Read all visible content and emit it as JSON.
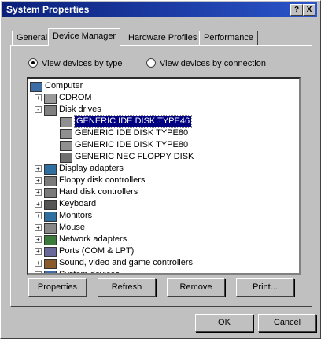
{
  "window": {
    "title": "System Properties",
    "help_btn": "?",
    "close_btn": "X"
  },
  "tabs": [
    "General",
    "Device Manager",
    "Hardware Profiles",
    "Performance"
  ],
  "view": {
    "by_type": "View devices by type",
    "by_connection": "View devices by connection",
    "selected": "by_type"
  },
  "tree": [
    {
      "label": "Computer",
      "icon": "computer-icon",
      "level": 0,
      "expander": ""
    },
    {
      "label": "CDROM",
      "icon": "cdrom-icon",
      "level": 1,
      "expander": "+"
    },
    {
      "label": "Disk drives",
      "icon": "disk-drive-icon",
      "level": 1,
      "expander": "-"
    },
    {
      "label": "GENERIC IDE  DISK TYPE46",
      "icon": "hard-disk-icon",
      "level": 2,
      "expander": "",
      "selected": true
    },
    {
      "label": "GENERIC IDE  DISK TYPE80",
      "icon": "hard-disk-icon",
      "level": 2,
      "expander": ""
    },
    {
      "label": "GENERIC IDE  DISK TYPE80",
      "icon": "hard-disk-icon",
      "level": 2,
      "expander": ""
    },
    {
      "label": "GENERIC NEC  FLOPPY DISK",
      "icon": "floppy-icon",
      "level": 2,
      "expander": ""
    },
    {
      "label": "Display adapters",
      "icon": "display-icon",
      "level": 1,
      "expander": "+"
    },
    {
      "label": "Floppy disk controllers",
      "icon": "controller-icon",
      "level": 1,
      "expander": "+"
    },
    {
      "label": "Hard disk controllers",
      "icon": "controller-icon",
      "level": 1,
      "expander": "+"
    },
    {
      "label": "Keyboard",
      "icon": "keyboard-icon",
      "level": 1,
      "expander": "+"
    },
    {
      "label": "Monitors",
      "icon": "monitor-icon",
      "level": 1,
      "expander": "+"
    },
    {
      "label": "Mouse",
      "icon": "mouse-icon",
      "level": 1,
      "expander": "+"
    },
    {
      "label": "Network adapters",
      "icon": "network-icon",
      "level": 1,
      "expander": "+"
    },
    {
      "label": "Ports (COM & LPT)",
      "icon": "port-icon",
      "level": 1,
      "expander": "+"
    },
    {
      "label": "Sound, video and game controllers",
      "icon": "sound-icon",
      "level": 1,
      "expander": "+"
    },
    {
      "label": "System devices",
      "icon": "system-icon",
      "level": 1,
      "expander": "+"
    }
  ],
  "buttons": {
    "properties": "Properties",
    "refresh": "Refresh",
    "remove": "Remove",
    "print": "Print...",
    "ok": "OK",
    "cancel": "Cancel"
  },
  "scrollbar": {
    "up": "▲",
    "down": "▼"
  }
}
